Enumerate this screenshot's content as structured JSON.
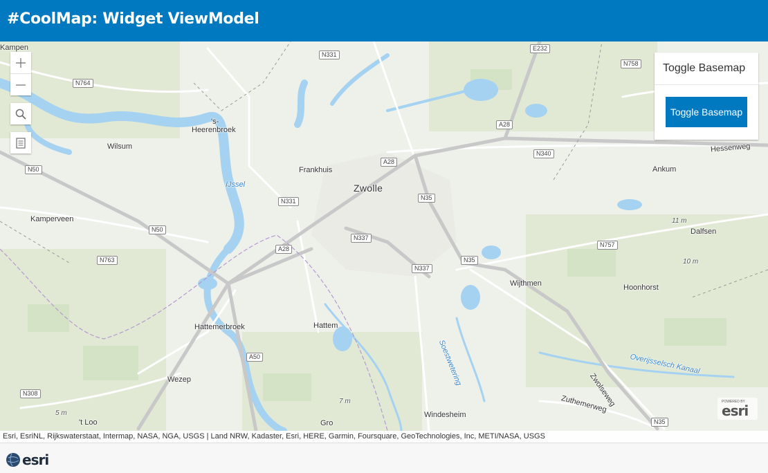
{
  "header": {
    "title": "#CoolMap: Widget ViewModel"
  },
  "panel": {
    "title": "Toggle Basemap",
    "button_label": "Toggle Basemap"
  },
  "attribution": "Esri, EsriNL, Rijkswaterstaat, Intermap, NASA, NGA, USGS | Land NRW, Kadaster, Esri, HERE, Garmin, Foursquare, GeoTechnologies, Inc, METI/NASA, USGS",
  "footer": {
    "logo_text": "esri"
  },
  "map_badge": {
    "powered": "POWERED BY",
    "brand": "esri"
  },
  "places": [
    "Kampen",
    "'s-",
    "Heerenbroek",
    "Wilsum",
    "Frankhuis",
    "Zwolle",
    "Ankum",
    "Kamperveen",
    "Dalfsen",
    "Wijthmen",
    "Hoonhorst",
    "Hattemerbroek",
    "Hattem",
    "Wezep",
    "'t Loo",
    "Windesheim",
    "Gro"
  ],
  "water_labels": [
    "IJssel",
    "Soestwetering",
    "Overijsselsch Kanaal"
  ],
  "street_labels": [
    "Hessenweg",
    "Zwolseweg",
    "Zuthemerweg"
  ],
  "elevations": [
    "11 m",
    "10 m",
    "7 m",
    "5 m"
  ],
  "roads": [
    "N331",
    "E232",
    "N758",
    "N764",
    "A28",
    "N340",
    "N50",
    "A28",
    "N35",
    "N331",
    "N50",
    "N337",
    "N757",
    "A28",
    "N763",
    "N337",
    "N35",
    "A50",
    "N308",
    "N35"
  ],
  "colors": {
    "header": "#0079c1",
    "button": "#0079c1",
    "water": "#a5d2f0",
    "road": "#ffffff",
    "highway": "#b5b5b5"
  }
}
